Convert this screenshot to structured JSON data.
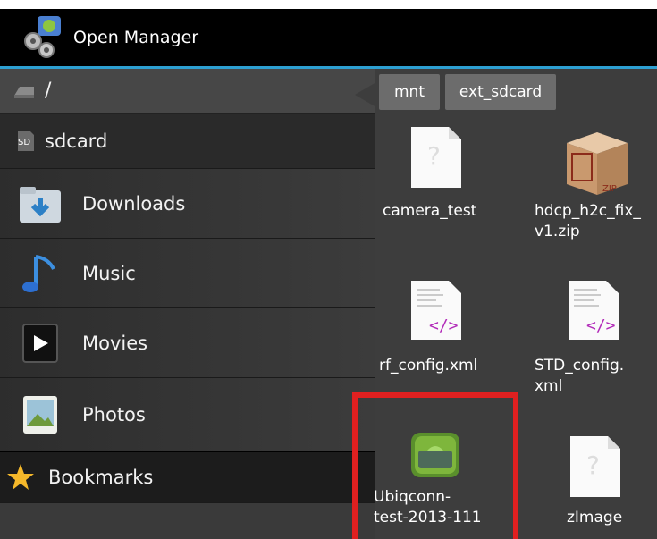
{
  "app": {
    "title": "Open Manager",
    "icon": "gears-android-icon"
  },
  "sidebar": {
    "root": {
      "label": "/",
      "icon": "drive-icon"
    },
    "sdcard": {
      "label": "sdcard",
      "badge": "SD"
    },
    "items": [
      {
        "label": "Downloads",
        "icon": "downloads-folder-icon"
      },
      {
        "label": "Music",
        "icon": "music-note-icon"
      },
      {
        "label": "Movies",
        "icon": "movie-play-icon"
      },
      {
        "label": "Photos",
        "icon": "photo-icon"
      },
      {
        "label": "Bookmarks",
        "icon": "star-icon"
      }
    ]
  },
  "breadcrumb": [
    "mnt",
    "ext_sdcard"
  ],
  "files": [
    {
      "name": "camera_test",
      "icon": "unknown-file-icon"
    },
    {
      "name": "hdcp_h2c_fix_\nv1.zip",
      "icon": "zip-box-icon",
      "badge": "ZIP"
    },
    {
      "name": "rf_config.xml",
      "icon": "xml-file-icon"
    },
    {
      "name": "STD_config.\nxml",
      "icon": "xml-file-icon"
    },
    {
      "name": "Ubiqconn-\ntest-2013-111",
      "icon": "apk-android-icon"
    },
    {
      "name": "zImage",
      "icon": "unknown-file-icon"
    }
  ],
  "colors": {
    "accent": "#2d9fd1",
    "highlight": "#e02020",
    "titlebar": "#000000"
  }
}
